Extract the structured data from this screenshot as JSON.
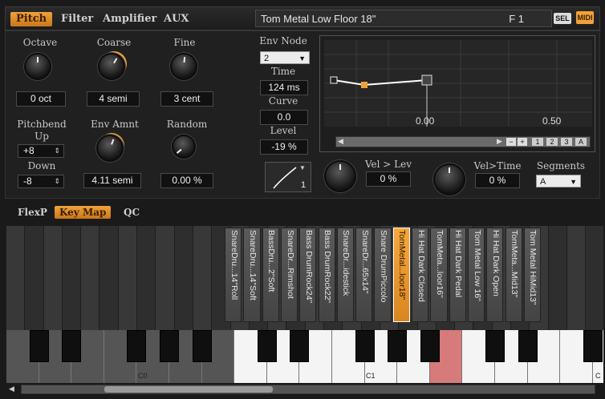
{
  "top_tabs": [
    "Pitch",
    "Filter",
    "Amplifier",
    "AUX"
  ],
  "active_top_tab": "Pitch",
  "program": {
    "name": "Tom Metal Low Floor 18\"",
    "slot": "F 1",
    "sel_label": "SEL",
    "midi_label": "MIDI"
  },
  "pitch": {
    "octave": {
      "label": "Octave",
      "value": "0 oct"
    },
    "coarse": {
      "label": "Coarse",
      "value": "4 semi"
    },
    "fine": {
      "label": "Fine",
      "value": "3 cent"
    },
    "pitchbend": {
      "label": "Pitchbend",
      "up_label": "Up",
      "up_value": "+8",
      "down_label": "Down",
      "down_value": "-8"
    },
    "env_amnt": {
      "label": "Env Amnt",
      "value": "4.11 semi"
    },
    "random": {
      "label": "Random",
      "value": "0.00 %"
    }
  },
  "env": {
    "node_label": "Env Node",
    "node_value": "2",
    "time_label": "Time",
    "time_value": "124 ms",
    "curve_label": "Curve",
    "curve_value": "0.0",
    "level_label": "Level",
    "level_value": "-19 %",
    "tick_labels": [
      "0.00",
      "0.50"
    ],
    "zoom_buttons": [
      "1",
      "2",
      "3",
      "A"
    ],
    "curve_number": "1",
    "vel_lev_label": "Vel > Lev",
    "vel_lev_value": "0 %",
    "vel_time_label": "Vel>Time",
    "vel_time_value": "0 %",
    "segments_label": "Segments",
    "segments_value": "A"
  },
  "lower_tabs": [
    "FlexP",
    "Key Map",
    "QC"
  ],
  "active_lower_tab": "Key Map",
  "zones": [
    "SnareDru...14\"Roll",
    "SnareDru...14\"Soft",
    "BassDru...2\"Soft",
    "SnareDr...Rimshot",
    "Bass DrumRock24\"",
    "Bass DrumRock22\"",
    "SnareDr...idestick",
    "SnareDr...65x14\"",
    "Snare DrumPiccolo",
    "TomMetal...loor18\"",
    "Hi Hat Dark Closed",
    "TomMeta...loor16\"",
    "Hi Hat Dark Pedal",
    "Tom Metal Low 16\"",
    "Hi Hat Dark Open",
    "TomMeta...Mid13\"",
    "Tom Metal HiMid13\""
  ],
  "selected_zone_index": 9,
  "key_labels": [
    "C0",
    "C1",
    "C"
  ]
}
